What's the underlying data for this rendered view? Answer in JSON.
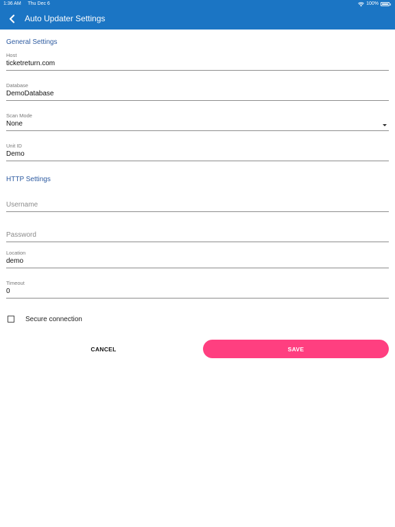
{
  "status_bar": {
    "time": "1:36 AM",
    "date": "Thu Dec 6",
    "battery": "100%"
  },
  "toolbar": {
    "title": "Auto Updater Settings"
  },
  "general": {
    "section_title": "General Settings",
    "host_label": "Host",
    "host_value": "ticketreturn.com",
    "database_label": "Database",
    "database_value": "DemoDatabase",
    "scan_mode_label": "Scan Mode",
    "scan_mode_value": "None",
    "unit_id_label": "Unit ID",
    "unit_id_value": "Demo"
  },
  "http": {
    "section_title": "HTTP Settings",
    "username_placeholder": "Username",
    "password_placeholder": "Password",
    "location_label": "Location",
    "location_value": "demo",
    "timeout_label": "Timeout",
    "timeout_value": "0",
    "secure_label": "Secure connection"
  },
  "actions": {
    "cancel_label": "CANCEL",
    "save_label": "SAVE"
  },
  "colors": {
    "header": "#1b75c4",
    "section": "#2c5aa0",
    "save": "#ff3f80"
  },
  "icons": {
    "back": "chevron-left-icon",
    "wifi": "wifi-icon",
    "battery": "battery-icon",
    "dropdown": "caret-down-icon"
  }
}
